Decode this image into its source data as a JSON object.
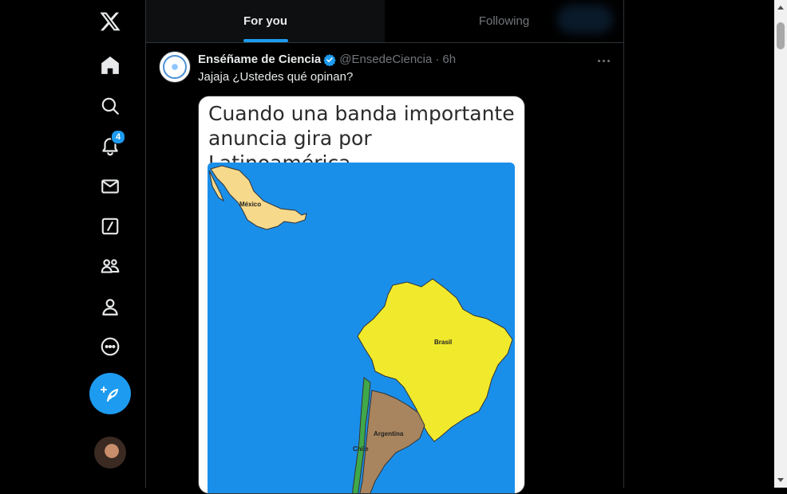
{
  "nav": {
    "items": [
      {
        "name": "x-logo-icon"
      },
      {
        "name": "home-icon"
      },
      {
        "name": "search-icon"
      },
      {
        "name": "bell-icon",
        "badge": "4"
      },
      {
        "name": "mail-icon"
      },
      {
        "name": "grok-icon"
      },
      {
        "name": "communities-icon"
      },
      {
        "name": "profile-icon"
      },
      {
        "name": "more-circle-icon"
      }
    ],
    "post_icon": "feather-plus-icon"
  },
  "tabs": [
    {
      "label": "For you",
      "active": true
    },
    {
      "label": "Following",
      "active": false
    }
  ],
  "tweet": {
    "author_name": "Enséñame de Ciencia",
    "handle": "@EnsedeCiencia",
    "separator": "·",
    "time": "6h",
    "text": "Jajaja ¿Ustedes qué opinan?",
    "media": {
      "caption_line1": "Cuando una banda importante",
      "caption_line2": "anuncia gira por Latinoamérica.",
      "labels": {
        "mexico": "México",
        "brasil": "Brasil",
        "argentina": "Argentina",
        "chile": "Chile"
      }
    }
  },
  "colors": {
    "accent": "#1d9bf0",
    "background": "#000000",
    "text": "#e7e9ea",
    "muted": "#71767b"
  }
}
